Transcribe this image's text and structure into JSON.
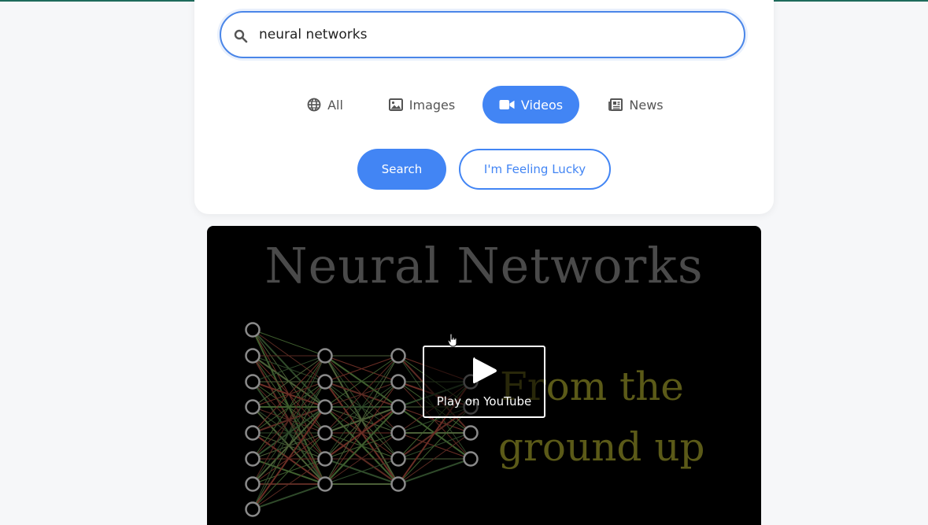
{
  "search": {
    "query": "neural networks"
  },
  "tabs": [
    {
      "label": "All",
      "icon": "globe-icon",
      "active": false
    },
    {
      "label": "Images",
      "icon": "image-icon",
      "active": false
    },
    {
      "label": "Videos",
      "icon": "video-icon",
      "active": true
    },
    {
      "label": "News",
      "icon": "newspaper-icon",
      "active": false
    }
  ],
  "buttons": {
    "search_label": "Search",
    "lucky_label": "I'm Feeling Lucky"
  },
  "video": {
    "thumbnail_title": "Neural Networks",
    "thumbnail_subtitle_line1": "From the",
    "thumbnail_subtitle_line2": "ground up",
    "play_label": "Play on YouTube"
  },
  "colors": {
    "accent": "#4285f4",
    "top_border": "#1e6b5c",
    "background": "#f6f7f9"
  }
}
